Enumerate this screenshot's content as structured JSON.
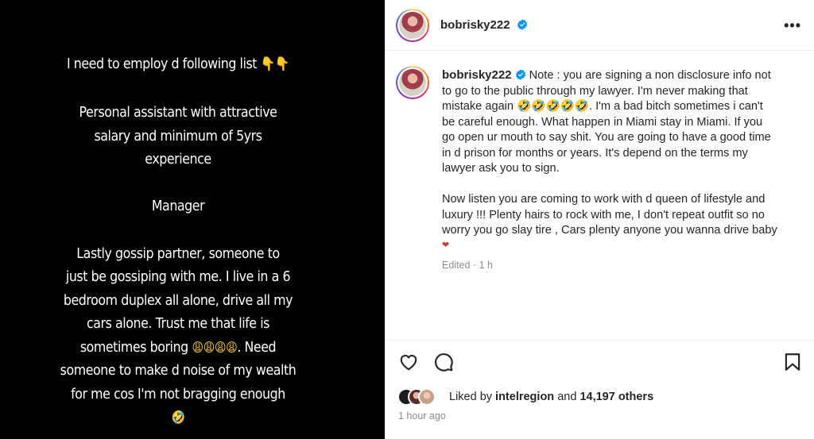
{
  "post": {
    "username": "bobrisky222",
    "more_icon": "more-horizontal-icon",
    "verified_icon": "verified-badge-icon",
    "verified_color": "#0095f6"
  },
  "media": {
    "lines": [
      "I need to employ d following list",
      "Personal assistant with  attractive",
      "salary and minimum of 5yrs",
      "experience",
      "Manager",
      "Lastly gossip partner, someone to",
      "just be gossiping with me. I live in a 6",
      "bedroom duplex all alone, drive all my",
      "cars alone. Trust me that life is",
      "sometimes boring",
      ". Need",
      "someone to make d noise of my wealth",
      "for me cos I'm not bragging enough"
    ],
    "emoji_hand": "👇",
    "emoji_weary": "😩",
    "emoji_rofl": "🤣"
  },
  "caption": {
    "lines": [
      "Note : you are signing a non disclosure info not",
      "to go to the public through my lawyer. I'm never making that",
      "mistake again",
      ". I'm a bad bitch sometimes i can't",
      "be careful enough. What happen in Miami stay in Miami. If you",
      "go open ur mouth to say shit. You are going to have a good time",
      "in d prison for months or years. It's depend on the terms my",
      "lawyer ask you to sign.",
      "Now listen you are coming to work with d queen of lifestyle and",
      "luxury !!! Plenty hairs to rock with me, I don't repeat outfit so no",
      "worry you go slay tire , Cars plenty anyone you wanna drive baby"
    ],
    "emoji_rofl": "🤣",
    "heart": "❤",
    "edited": "Edited",
    "separator": "·",
    "edited_time": "1 h"
  },
  "actions": {
    "like_icon": "heart-outline-icon",
    "comment_icon": "comment-icon",
    "save_icon": "bookmark-icon"
  },
  "likes": {
    "prefix": "Liked by",
    "user": "intelregion",
    "connector": "and",
    "count": "14,197 others"
  },
  "timestamp": "1 hour ago",
  "colors": {
    "media_bg": "#000000",
    "muted": "#8e8e8e",
    "text": "#262626"
  }
}
